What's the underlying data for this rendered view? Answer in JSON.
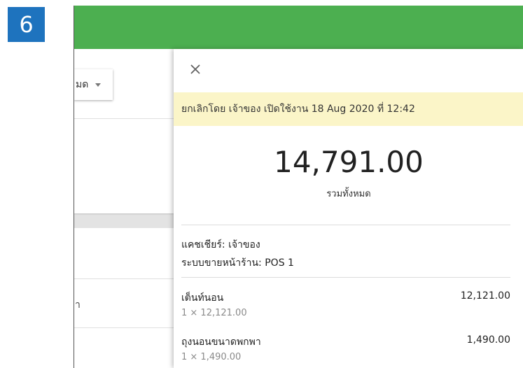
{
  "step_badge": "6",
  "background": {
    "select_text": "มด",
    "row_text": "า"
  },
  "drawer": {
    "close_icon": "close-icon",
    "cancel_banner": "ยกเลิกโดย เจ้าของ เปิดใช้งาน 18 Aug 2020 ที่ 12:42",
    "total_amount": "14,791.00",
    "total_label": "รวมทั้งหมด",
    "cashier_line": "แคชเชียร์: เจ้าของ",
    "pos_line": "ระบบขายหน้าร้าน: POS 1",
    "items": [
      {
        "name": "เต็นท์นอน",
        "price": "12,121.00",
        "qty": "1 × 12,121.00"
      },
      {
        "name": "ถุงนอนขนาดพกพา",
        "price": "1,490.00",
        "qty": "1 × 1,490.00"
      }
    ]
  },
  "colors": {
    "header_green": "#4caf50",
    "badge_blue": "#1e73be",
    "banner_yellow": "#fbf5c8"
  }
}
